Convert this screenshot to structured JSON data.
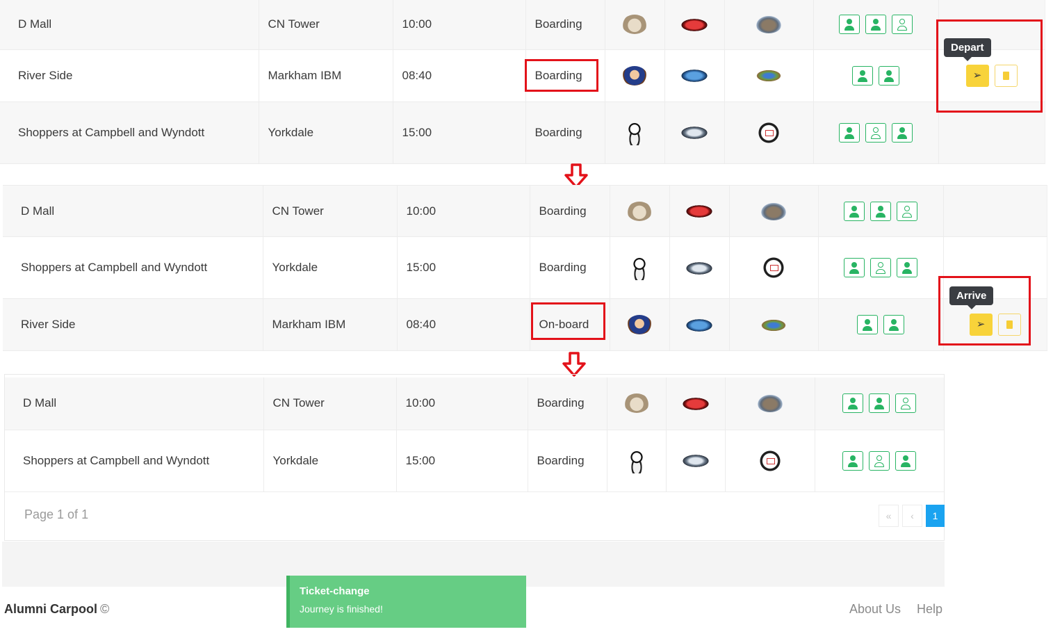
{
  "section1": {
    "rows": [
      {
        "from": "D Mall",
        "to": "CN Tower",
        "time": "10:00",
        "status": "Boarding",
        "seats": [
          "full",
          "full",
          "open"
        ]
      },
      {
        "from": "River Side",
        "to": "Markham IBM",
        "time": "08:40",
        "status": "Boarding",
        "seats": [
          "full",
          "full"
        ]
      },
      {
        "from": "Shoppers at Campbell and Wyndott",
        "to": "Yorkdale",
        "time": "15:00",
        "status": "Boarding",
        "seats": [
          "full",
          "open",
          "full"
        ]
      }
    ],
    "tooltip": "Depart"
  },
  "section2": {
    "rows": [
      {
        "from": "D Mall",
        "to": "CN Tower",
        "time": "10:00",
        "status": "Boarding",
        "seats": [
          "full",
          "full",
          "open"
        ]
      },
      {
        "from": "Shoppers at Campbell and Wyndott",
        "to": "Yorkdale",
        "time": "15:00",
        "status": "Boarding",
        "seats": [
          "full",
          "open",
          "full"
        ]
      },
      {
        "from": "River Side",
        "to": "Markham IBM",
        "time": "08:40",
        "status": "On-board",
        "seats": [
          "full",
          "full"
        ]
      }
    ],
    "tooltip": "Arrive"
  },
  "section3": {
    "rows": [
      {
        "from": "D Mall",
        "to": "CN Tower",
        "time": "10:00",
        "status": "Boarding",
        "seats": [
          "full",
          "full",
          "open"
        ]
      },
      {
        "from": "Shoppers at Campbell and Wyndott",
        "to": "Yorkdale",
        "time": "15:00",
        "status": "Boarding",
        "seats": [
          "full",
          "open",
          "full"
        ]
      }
    ],
    "page_info": "Page 1 of 1",
    "pager": {
      "first": "«",
      "prev": "‹",
      "current": "1"
    }
  },
  "toast": {
    "title": "Ticket-change",
    "message": "Journey is finished!"
  },
  "footer": {
    "brand": "Alumni Carpool",
    "copyright": "©",
    "links": [
      "About Us",
      "Help"
    ]
  },
  "colors": {
    "highlight": "#e3121a",
    "seat_green": "#28b463",
    "action_yellow": "#f8d33a",
    "toast_green": "#66cd84",
    "page_active": "#1aa3f0"
  },
  "icons": {
    "depart": "paper-plane-icon",
    "delete": "trash-icon",
    "seat": "user-icon",
    "arrow": "arrow-down-icon"
  }
}
